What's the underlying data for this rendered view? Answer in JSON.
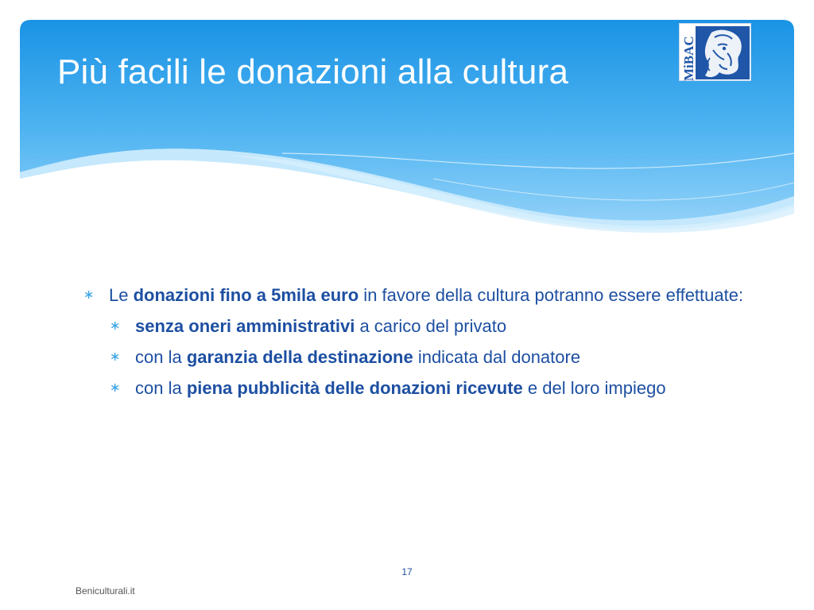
{
  "slide": {
    "title": "Più facili le donazioni alla cultura",
    "logo_text": "MiBAC",
    "page_number": "17",
    "footer": "Beniculturali.it"
  },
  "bullets": {
    "main": {
      "pre": "Le ",
      "bold": "donazioni fino a 5mila euro",
      "post": " in favore della cultura potranno essere effettuate:"
    },
    "sub": [
      {
        "pre": "",
        "bold": "senza oneri amministrativi",
        "post": " a carico del privato"
      },
      {
        "pre": "con la ",
        "bold": "garanzia della destinazione",
        "post": " indicata dal donatore"
      },
      {
        "pre": "con la ",
        "bold": "piena pubblicità delle donazioni ricevute",
        "post": " e del loro impiego"
      }
    ],
    "marker": "∗"
  },
  "colors": {
    "header_top": "#1e96e6",
    "header_bottom": "#9fd7fb",
    "text": "#1d4fa2",
    "marker": "#35a3e6",
    "logo_blue": "#1f56a8"
  }
}
